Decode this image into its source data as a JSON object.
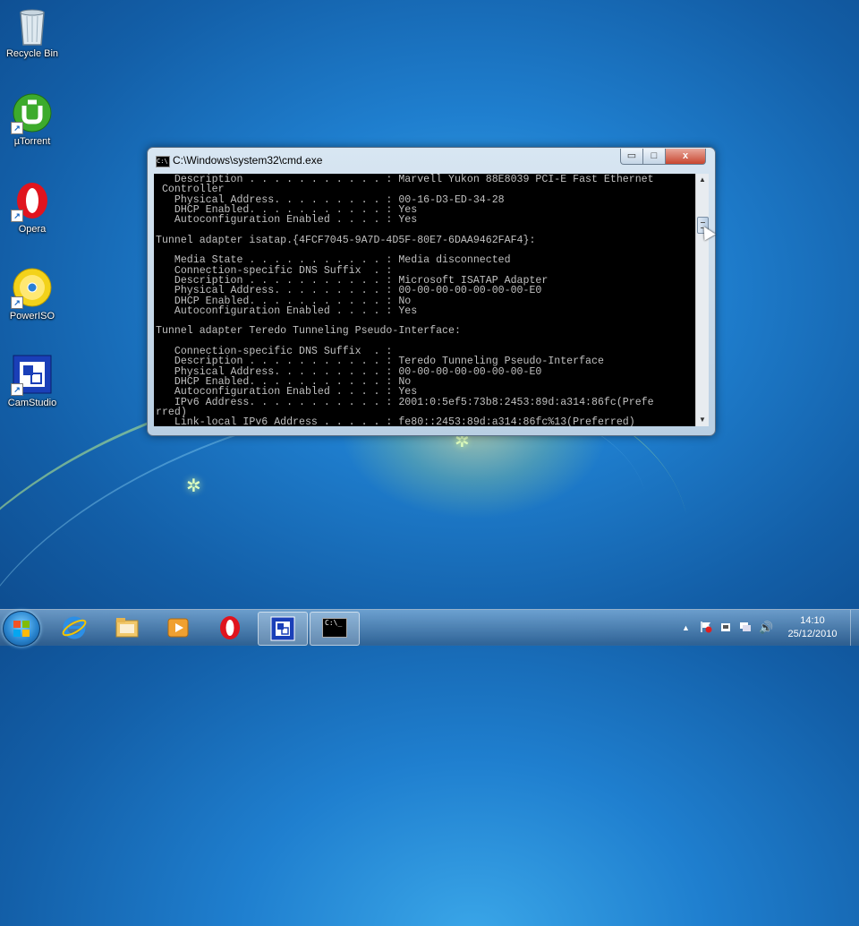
{
  "desktop": {
    "icons": [
      {
        "label": "Recycle Bin"
      },
      {
        "label": "µTorrent"
      },
      {
        "label": "Opera"
      },
      {
        "label": "PowerISO"
      },
      {
        "label": "CamStudio"
      }
    ]
  },
  "window": {
    "title": "C:\\Windows\\system32\\cmd.exe",
    "minimize_label": "▭",
    "maximize_label": "□",
    "close_label": "x",
    "icon_glyph": "C:\\",
    "console_text": "   Description . . . . . . . . . . . : Marvell Yukon 88E8039 PCI-E Fast Ethernet\n Controller\n   Physical Address. . . . . . . . . : 00-16-D3-ED-34-28\n   DHCP Enabled. . . . . . . . . . . : Yes\n   Autoconfiguration Enabled . . . . : Yes\n\nTunnel adapter isatap.{4FCF7045-9A7D-4D5F-80E7-6DAA9462FAF4}:\n\n   Media State . . . . . . . . . . . : Media disconnected\n   Connection-specific DNS Suffix  . :\n   Description . . . . . . . . . . . : Microsoft ISATAP Adapter\n   Physical Address. . . . . . . . . : 00-00-00-00-00-00-00-E0\n   DHCP Enabled. . . . . . . . . . . : No\n   Autoconfiguration Enabled . . . . : Yes\n\nTunnel adapter Teredo Tunneling Pseudo-Interface:\n\n   Connection-specific DNS Suffix  . :\n   Description . . . . . . . . . . . : Teredo Tunneling Pseudo-Interface\n   Physical Address. . . . . . . . . : 00-00-00-00-00-00-00-E0\n   DHCP Enabled. . . . . . . . . . . : No\n   Autoconfiguration Enabled . . . . : Yes\n   IPv6 Address. . . . . . . . . . . : 2001:0:5ef5:73b8:2453:89d:a314:86fc(Prefe\nrred)\n   Link-local IPv6 Address . . . . . : fe80::2453:89d:a314:86fc%13(Preferred)"
  },
  "taskbar": {
    "items": [
      {
        "name": "internet-explorer"
      },
      {
        "name": "windows-explorer"
      },
      {
        "name": "media-player"
      },
      {
        "name": "opera"
      },
      {
        "name": "camstudio"
      },
      {
        "name": "cmd"
      }
    ],
    "cmd_glyph": "C:\\_",
    "tray": {
      "show_hidden": "▲",
      "volume": "🔊"
    },
    "clock": {
      "time": "14:10",
      "date": "25/12/2010"
    }
  }
}
